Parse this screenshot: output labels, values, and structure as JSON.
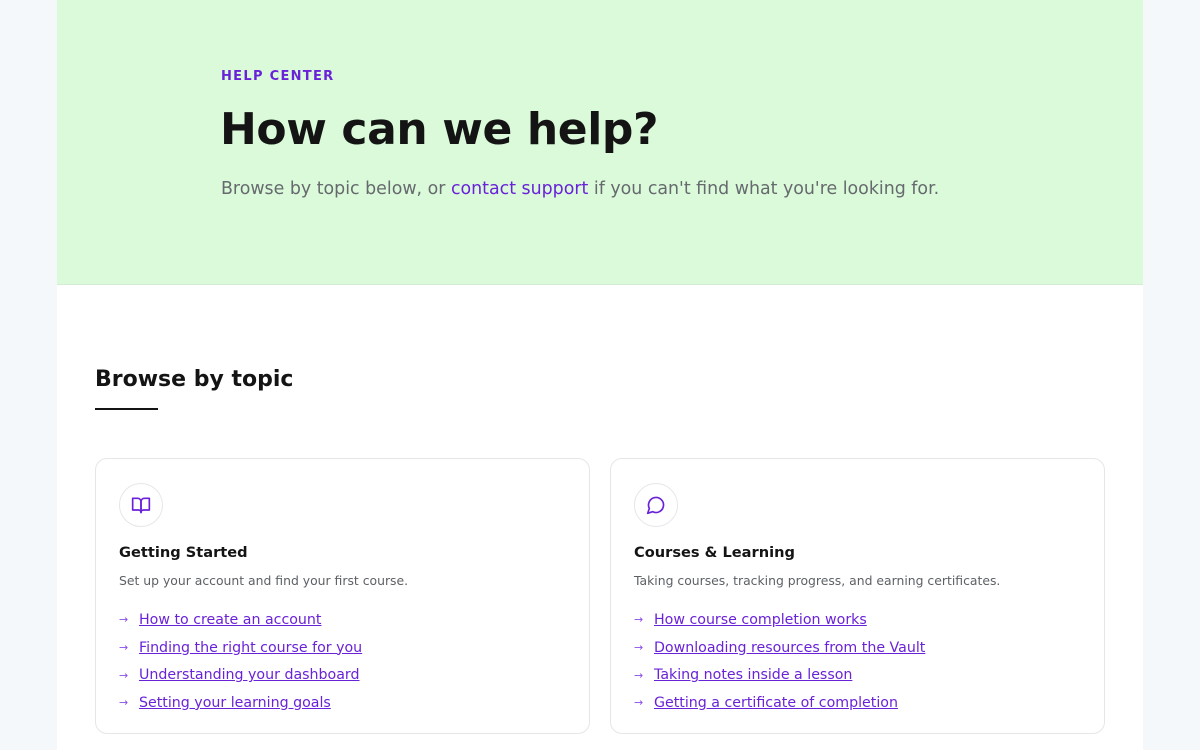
{
  "hero": {
    "eyebrow": "HELP CENTER",
    "title": "How can we help?",
    "subtitle_before": "Browse by topic below, or ",
    "subtitle_link": "contact support",
    "subtitle_after": " if you can't find what you're looking for."
  },
  "section": {
    "title": "Browse by topic"
  },
  "topics": [
    {
      "icon": "book-open-icon",
      "title": "Getting Started",
      "description": "Set up your account and find your first course.",
      "links": [
        "How to create an account",
        "Finding the right course for you",
        "Understanding your dashboard",
        "Setting your learning goals"
      ]
    },
    {
      "icon": "message-circle-icon",
      "title": "Courses & Learning",
      "description": "Taking courses, tracking progress, and earning certificates.",
      "links": [
        "How course completion works",
        "Downloading resources from the Vault",
        "Taking notes inside a lesson",
        "Getting a certificate of completion"
      ]
    }
  ],
  "colors": {
    "accent": "#6a22d8",
    "hero_bg": "#dafada",
    "page_bg": "#f5f8fb"
  }
}
